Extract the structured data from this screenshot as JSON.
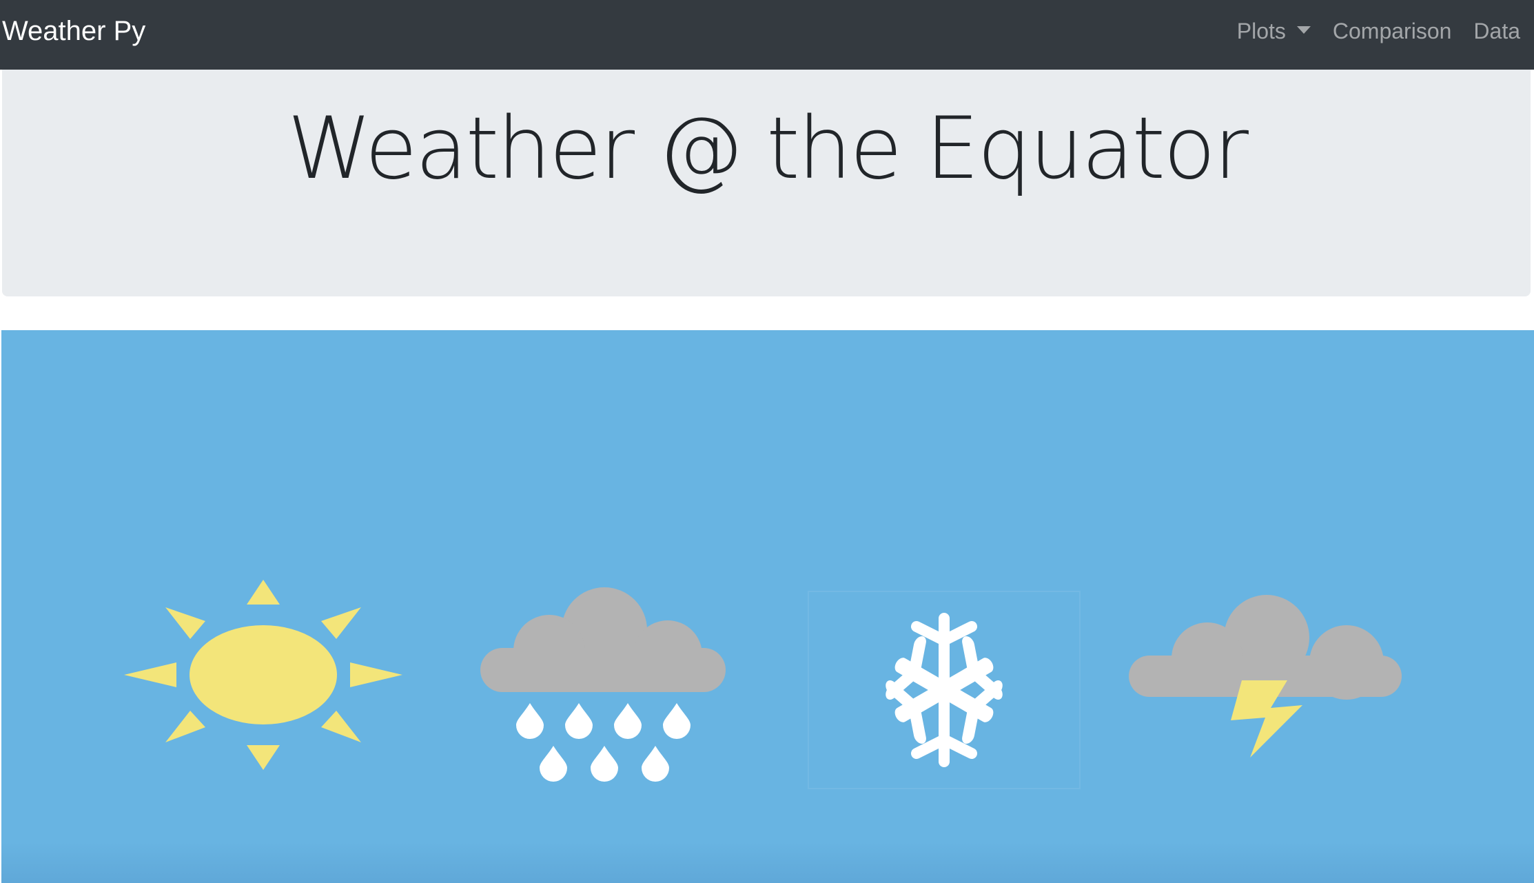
{
  "navbar": {
    "brand": "Weather Py",
    "links": [
      {
        "label": "Plots",
        "dropdown": true
      },
      {
        "label": "Comparison"
      },
      {
        "label": "Data"
      }
    ],
    "background_color": "#343a40"
  },
  "jumbotron": {
    "title": "Weather @ the Equator",
    "background_color": "#e9ecef"
  },
  "hero_image": {
    "background_color": "#68b4e2",
    "icons": [
      "sun-icon",
      "rain-cloud-icon",
      "snowflake-icon",
      "thunderstorm-icon"
    ],
    "colors": {
      "sun": "#f3e57a",
      "cloud": "#b3b3b3",
      "snow": "#ffffff",
      "bolt": "#f3e57a"
    }
  }
}
